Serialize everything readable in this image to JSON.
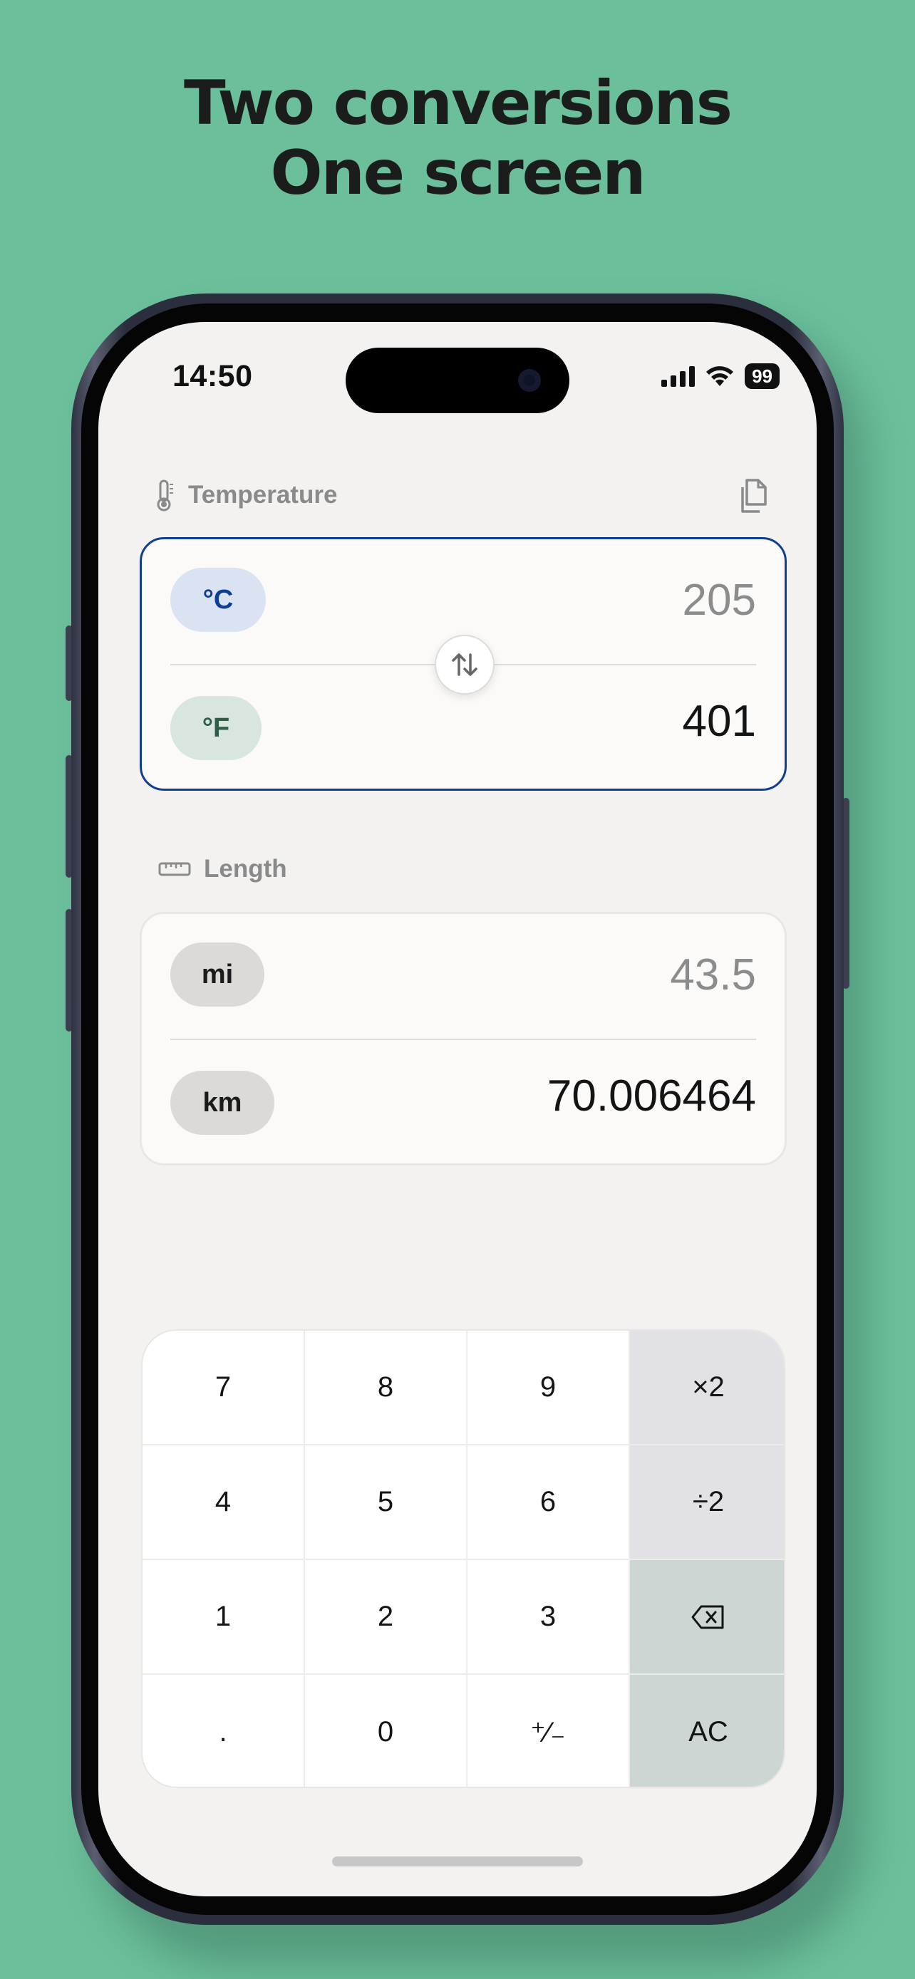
{
  "headline": {
    "line1": "Two conversions",
    "line2": "One screen"
  },
  "status_bar": {
    "time": "14:50",
    "battery": "99"
  },
  "temperature": {
    "section_label": "Temperature",
    "from_unit": "°C",
    "from_value": "205",
    "to_unit": "°F",
    "to_value": "401",
    "active_border_color": "#0f3f94",
    "from_pill_color": "#d9e3f1",
    "to_pill_color": "#d9e5df"
  },
  "length": {
    "section_label": "Length",
    "from_unit": "mi",
    "from_value": "43.5",
    "to_unit": "km",
    "to_value": "70.006464",
    "pill_color": "#dcdad7"
  },
  "keypad": {
    "keys": [
      "7",
      "8",
      "9",
      "×2",
      "4",
      "5",
      "6",
      "÷2",
      "1",
      "2",
      "3",
      "backspace",
      ".",
      "0",
      "⁺∕₋",
      "AC"
    ]
  },
  "colors": {
    "background": "#6bbf9b",
    "accent": "#0f3f94"
  }
}
